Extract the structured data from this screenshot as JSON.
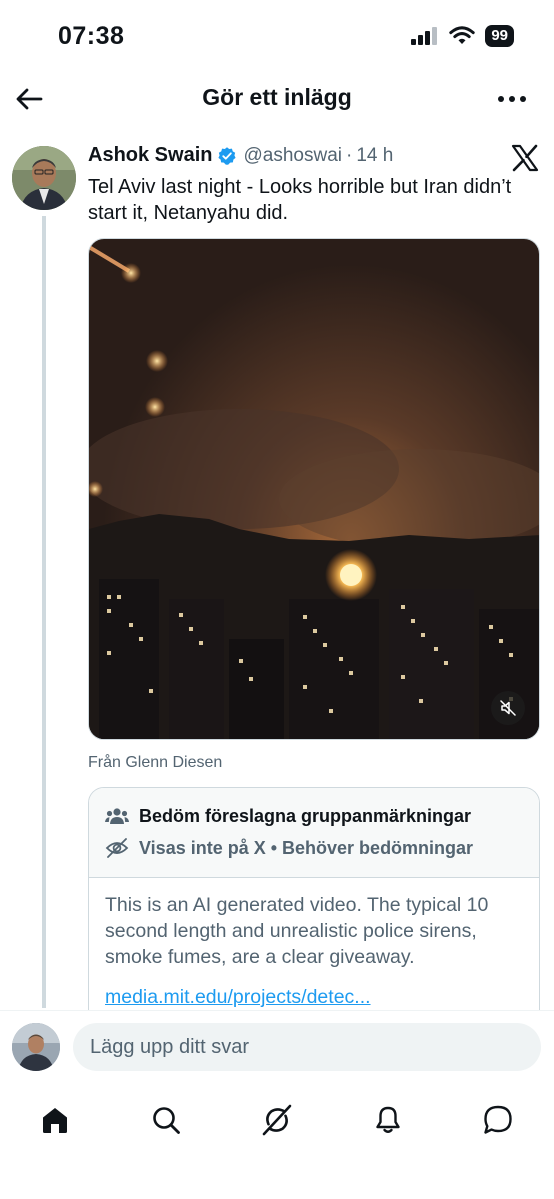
{
  "status_bar": {
    "time": "07:38",
    "battery": "99"
  },
  "nav": {
    "title": "Gör ett inlägg",
    "back_icon": "arrow-left-icon",
    "more_icon": "more-horizontal-icon"
  },
  "post": {
    "author_name": "Ashok Swain",
    "handle": "@ashoswai",
    "separator": "·",
    "time_ago": "14 h",
    "text": "Tel Aviv last night - Looks horrible but Iran didn’t start it, Netanyahu did.",
    "source": "Från Glenn Diesen",
    "verified_color": "#1d9bf0"
  },
  "community_note": {
    "rate_label": "Bedöm föreslagna gruppanmärkningar",
    "status_label": "Visas inte på X • Behöver bedömningar",
    "note_text": "This is an AI generated video. The typical 10 second length and unrealistic police sirens, smoke fumes, are a clear giveaway.",
    "link_text": "media.mit.edu/projects/detec..."
  },
  "reply": {
    "placeholder": "Lägg upp ditt svar"
  },
  "tabs": [
    {
      "name": "home",
      "icon": "home-icon"
    },
    {
      "name": "search",
      "icon": "search-icon"
    },
    {
      "name": "grok",
      "icon": "grok-icon"
    },
    {
      "name": "notifications",
      "icon": "bell-icon"
    },
    {
      "name": "messages",
      "icon": "message-icon"
    }
  ],
  "colors": {
    "accent": "#1d9bf0",
    "text_secondary": "#536471",
    "border": "#cfd9de"
  }
}
